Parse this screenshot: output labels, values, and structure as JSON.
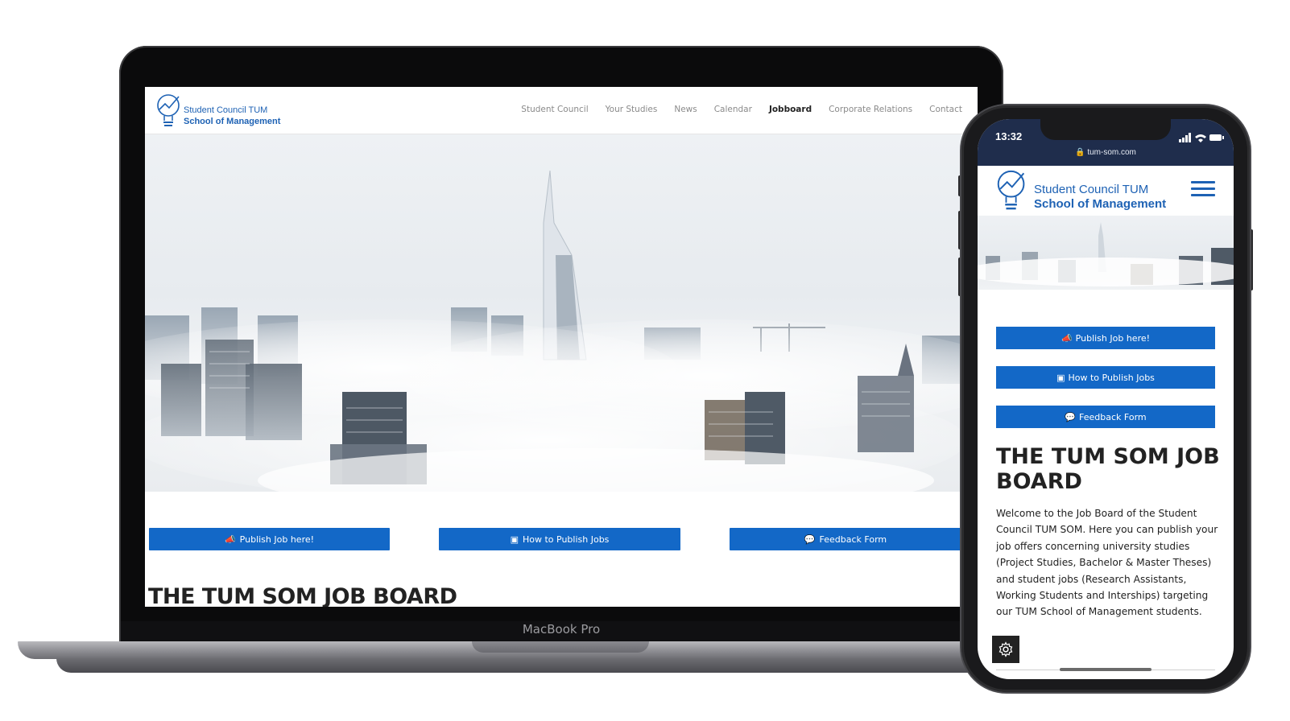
{
  "site": {
    "logo_line1": "Student Council TUM",
    "logo_line2": "School of Management",
    "nav": [
      "Student Council",
      "Your Studies",
      "News",
      "Calendar",
      "Jobboard",
      "Corporate Relations",
      "Contact"
    ],
    "nav_active": "Jobboard",
    "buttons": {
      "publish": "Publish Job here!",
      "how_to": "How to Publish Jobs",
      "feedback": "Feedback Form"
    },
    "heading": "THE TUM SOM JOB BOARD",
    "intro": "Welcome to the Job Board of the Student Council TUM SOM. Here you can publish your job offers concerning university studies (Project Studies, Bachelor & Master Theses) and student jobs (Research Assistants, Working Students and Interships) targeting our TUM School of Management students."
  },
  "laptop": {
    "model_label": "MacBook Pro"
  },
  "phone": {
    "time": "13:32",
    "url": "tum-som.com"
  },
  "icons": {
    "publish": "megaphone-icon",
    "how_to": "video-icon",
    "feedback": "comments-icon",
    "settings": "gear-icon",
    "menu": "hamburger-icon",
    "lock": "lock-icon"
  },
  "colors": {
    "brand_blue": "#1e62b4",
    "button_blue": "#1368c7",
    "phone_status_bar": "#1f2d4c"
  }
}
